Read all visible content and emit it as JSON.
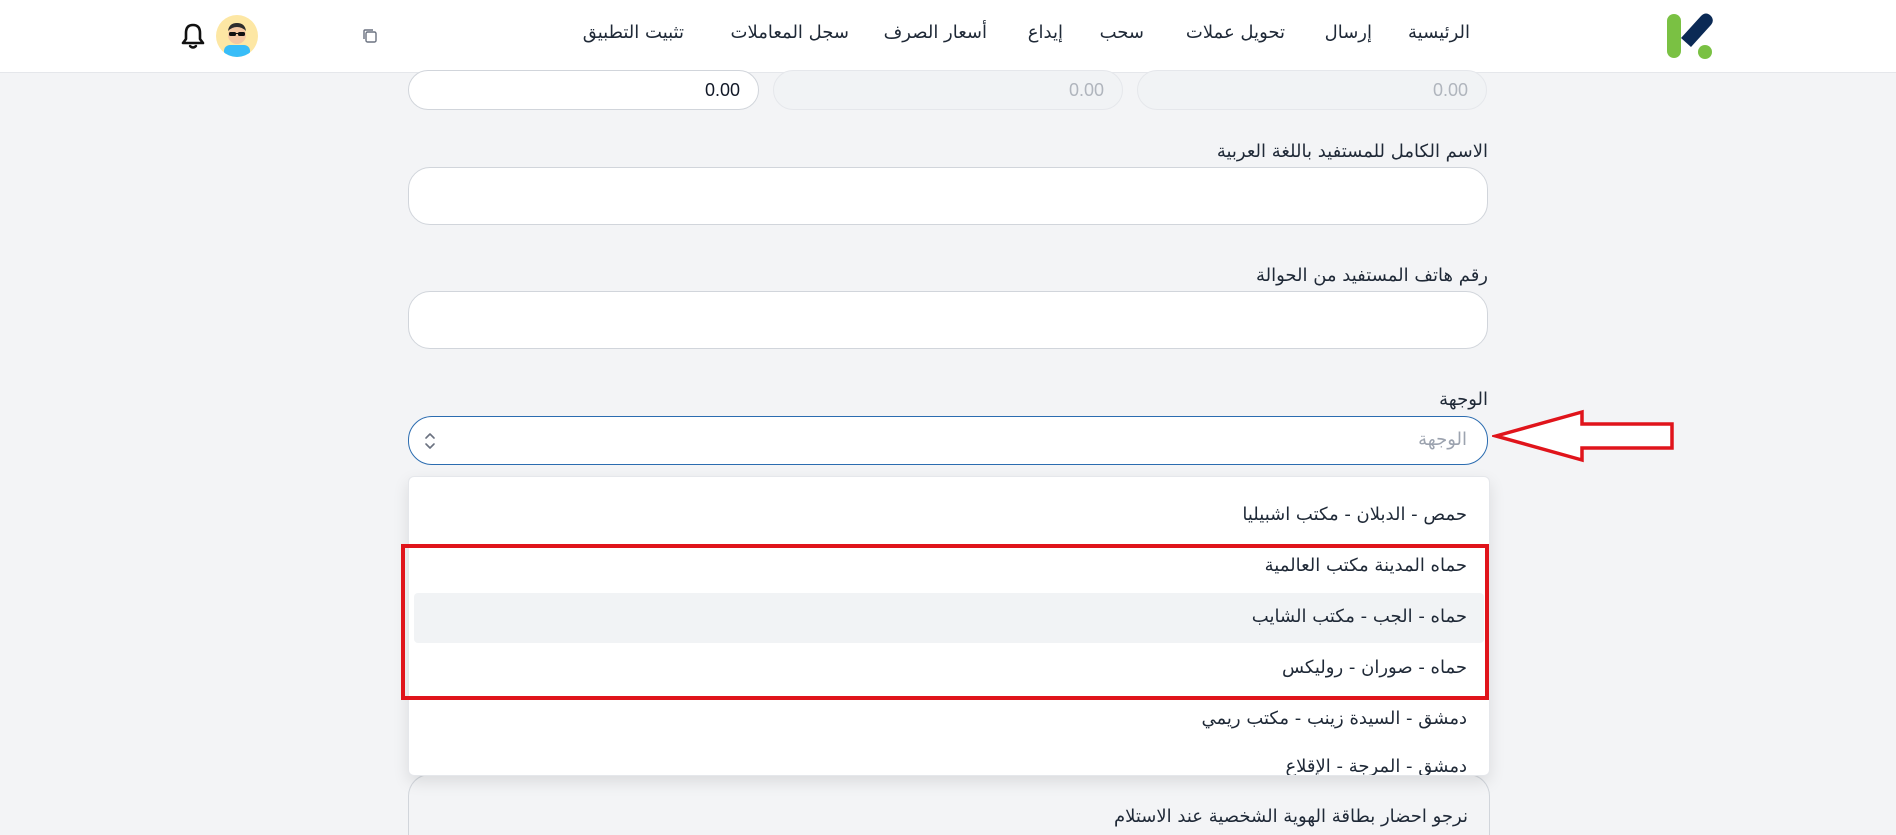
{
  "nav": {
    "items": [
      "الرئيسية",
      "إرسال",
      "تحويل عملات",
      "سحب",
      "إيداع",
      "أسعار الصرف",
      "سجل المعاملات",
      "تثبيت التطبيق"
    ],
    "logo_icon": "logo-icon",
    "copy_icon": "copy-icon",
    "avatar_icon": "avatar-icon",
    "bell_icon": "bell-icon"
  },
  "amounts": {
    "fields": [
      "0.00",
      "0.00",
      "0.00"
    ]
  },
  "form": {
    "full_name_label": "الاسم الكامل للمستفيد باللغة العربية",
    "full_name_value": "",
    "phone_label": "رقم هاتف المستفيد من الحوالة",
    "phone_value": "",
    "destination_label": "الوجهة",
    "destination_placeholder": "الوجهة"
  },
  "dropdown": {
    "options": [
      "حمص - الدبلان - مكتب اشبيليا",
      "حماه المدينة مكتب العالمية",
      "حماه - الجب - مكتب الشايب",
      "حماه - صوران - روليكس",
      "دمشق - السيدة زينب - مكتب ريمي",
      "دمشق - المرجة - الإقلاع"
    ],
    "hovered_option": "حماه - الجب - مكتب الشايب"
  },
  "below": {
    "note": "نرجو احضار بطاقة الهوية الشخصية عند الاستلام"
  },
  "colors": {
    "accent": "#2b6cb0",
    "annotation": "#e0141b",
    "logo_green": "#7ac143",
    "logo_navy": "#0b2a55"
  }
}
